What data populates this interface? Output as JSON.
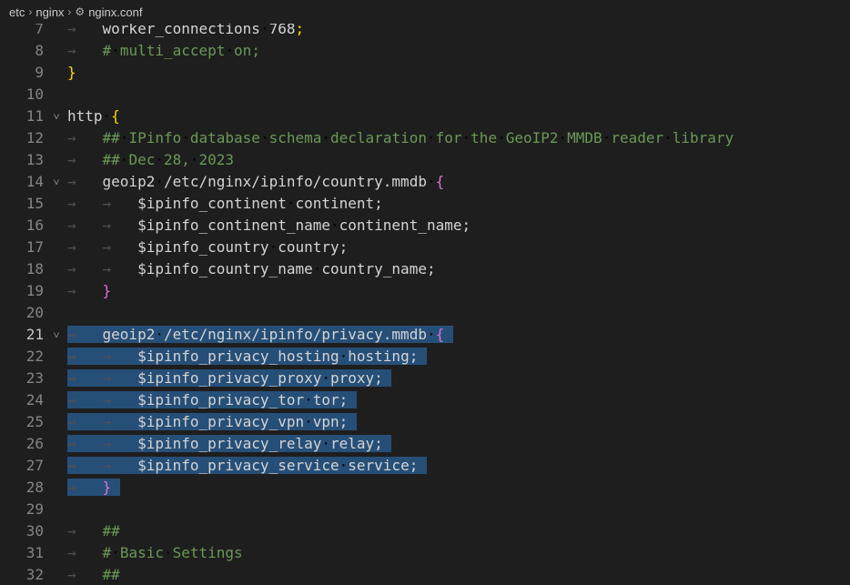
{
  "breadcrumb": {
    "items": [
      "etc",
      "nginx",
      "nginx.conf"
    ],
    "file_icon": "gear-icon"
  },
  "colors": {
    "background": "#1e1e1e",
    "selection": "#264f78",
    "comment": "#6a9955",
    "default": "#d4d4d4",
    "brace_level1": "#ffd700",
    "brace_level2": "#da70d6",
    "line_number": "#858585",
    "whitespace": "#505050"
  },
  "editor": {
    "active_line": 21,
    "lines": [
      {
        "n": "7",
        "indent": 1,
        "fold": "",
        "tokens": [
          {
            "t": "worker_connections",
            "c": "default"
          },
          {
            "t": " ",
            "c": "ws"
          },
          {
            "t": "768",
            "c": "default"
          },
          {
            "t": ";",
            "c": "brace1"
          }
        ]
      },
      {
        "n": "8",
        "indent": 1,
        "fold": "",
        "tokens": [
          {
            "t": "#",
            "c": "comment"
          },
          {
            "t": " ",
            "c": "ws"
          },
          {
            "t": "multi_accept",
            "c": "comment"
          },
          {
            "t": " ",
            "c": "ws"
          },
          {
            "t": "on;",
            "c": "comment"
          }
        ]
      },
      {
        "n": "9",
        "indent": 0,
        "fold": "",
        "tokens": [
          {
            "t": "}",
            "c": "brace1"
          }
        ]
      },
      {
        "n": "10",
        "indent": 0,
        "fold": "",
        "tokens": []
      },
      {
        "n": "11",
        "indent": 0,
        "fold": "open",
        "tokens": [
          {
            "t": "http",
            "c": "default"
          },
          {
            "t": " ",
            "c": "ws"
          },
          {
            "t": "{",
            "c": "brace1"
          }
        ]
      },
      {
        "n": "12",
        "indent": 1,
        "fold": "",
        "tokens": [
          {
            "t": "##",
            "c": "comment"
          },
          {
            "t": " ",
            "c": "ws"
          },
          {
            "t": "IPinfo",
            "c": "comment"
          },
          {
            "t": " ",
            "c": "ws"
          },
          {
            "t": "database",
            "c": "comment"
          },
          {
            "t": " ",
            "c": "ws"
          },
          {
            "t": "schema",
            "c": "comment"
          },
          {
            "t": " ",
            "c": "ws"
          },
          {
            "t": "declaration",
            "c": "comment"
          },
          {
            "t": " ",
            "c": "ws"
          },
          {
            "t": "for",
            "c": "comment"
          },
          {
            "t": " ",
            "c": "ws"
          },
          {
            "t": "the",
            "c": "comment"
          },
          {
            "t": " ",
            "c": "ws"
          },
          {
            "t": "GeoIP2",
            "c": "comment"
          },
          {
            "t": " ",
            "c": "ws"
          },
          {
            "t": "MMDB",
            "c": "comment"
          },
          {
            "t": " ",
            "c": "ws"
          },
          {
            "t": "reader",
            "c": "comment"
          },
          {
            "t": " ",
            "c": "ws"
          },
          {
            "t": "library",
            "c": "comment"
          }
        ]
      },
      {
        "n": "13",
        "indent": 1,
        "fold": "",
        "tokens": [
          {
            "t": "##",
            "c": "comment"
          },
          {
            "t": " ",
            "c": "ws"
          },
          {
            "t": "Dec",
            "c": "comment"
          },
          {
            "t": " ",
            "c": "ws"
          },
          {
            "t": "28,",
            "c": "comment"
          },
          {
            "t": " ",
            "c": "ws"
          },
          {
            "t": "2023",
            "c": "comment"
          }
        ]
      },
      {
        "n": "14",
        "indent": 1,
        "fold": "open",
        "tokens": [
          {
            "t": "geoip2",
            "c": "default"
          },
          {
            "t": " ",
            "c": "ws"
          },
          {
            "t": "/etc/nginx/ipinfo/country.mmdb",
            "c": "default"
          },
          {
            "t": " ",
            "c": "ws"
          },
          {
            "t": "{",
            "c": "brace2"
          }
        ]
      },
      {
        "n": "15",
        "indent": 2,
        "fold": "",
        "tokens": [
          {
            "t": "$ipinfo_continent",
            "c": "default"
          },
          {
            "t": " ",
            "c": "ws"
          },
          {
            "t": "continent;",
            "c": "default"
          }
        ]
      },
      {
        "n": "16",
        "indent": 2,
        "fold": "",
        "tokens": [
          {
            "t": "$ipinfo_continent_name",
            "c": "default"
          },
          {
            "t": " ",
            "c": "ws"
          },
          {
            "t": "continent_name;",
            "c": "default"
          }
        ]
      },
      {
        "n": "17",
        "indent": 2,
        "fold": "",
        "tokens": [
          {
            "t": "$ipinfo_country",
            "c": "default"
          },
          {
            "t": " ",
            "c": "ws"
          },
          {
            "t": "country;",
            "c": "default"
          }
        ]
      },
      {
        "n": "18",
        "indent": 2,
        "fold": "",
        "tokens": [
          {
            "t": "$ipinfo_country_name",
            "c": "default"
          },
          {
            "t": " ",
            "c": "ws"
          },
          {
            "t": "country_name;",
            "c": "default"
          }
        ]
      },
      {
        "n": "19",
        "indent": 1,
        "fold": "",
        "tokens": [
          {
            "t": "}",
            "c": "brace2"
          }
        ]
      },
      {
        "n": "20",
        "indent": 0,
        "fold": "",
        "tokens": []
      },
      {
        "n": "21",
        "indent": 1,
        "fold": "open",
        "sel": true,
        "tokens": [
          {
            "t": "geoip2",
            "c": "default"
          },
          {
            "t": " ",
            "c": "ws"
          },
          {
            "t": "/etc/nginx/ipinfo/privacy.mmdb",
            "c": "default"
          },
          {
            "t": " ",
            "c": "ws"
          },
          {
            "t": "{",
            "c": "brace2"
          }
        ]
      },
      {
        "n": "22",
        "indent": 2,
        "fold": "",
        "sel": true,
        "tokens": [
          {
            "t": "$ipinfo_privacy_hosting",
            "c": "default"
          },
          {
            "t": " ",
            "c": "ws"
          },
          {
            "t": "hosting;",
            "c": "default"
          }
        ]
      },
      {
        "n": "23",
        "indent": 2,
        "fold": "",
        "sel": true,
        "tokens": [
          {
            "t": "$ipinfo_privacy_proxy",
            "c": "default"
          },
          {
            "t": " ",
            "c": "ws"
          },
          {
            "t": "proxy;",
            "c": "default"
          }
        ]
      },
      {
        "n": "24",
        "indent": 2,
        "fold": "",
        "sel": true,
        "tokens": [
          {
            "t": "$ipinfo_privacy_tor",
            "c": "default"
          },
          {
            "t": " ",
            "c": "ws"
          },
          {
            "t": "tor;",
            "c": "default"
          }
        ]
      },
      {
        "n": "25",
        "indent": 2,
        "fold": "",
        "sel": true,
        "tokens": [
          {
            "t": "$ipinfo_privacy_vpn",
            "c": "default"
          },
          {
            "t": " ",
            "c": "ws"
          },
          {
            "t": "vpn;",
            "c": "default"
          }
        ]
      },
      {
        "n": "26",
        "indent": 2,
        "fold": "",
        "sel": true,
        "tokens": [
          {
            "t": "$ipinfo_privacy_relay",
            "c": "default"
          },
          {
            "t": " ",
            "c": "ws"
          },
          {
            "t": "relay;",
            "c": "default"
          }
        ]
      },
      {
        "n": "27",
        "indent": 2,
        "fold": "",
        "sel": true,
        "tokens": [
          {
            "t": "$ipinfo_privacy_service",
            "c": "default"
          },
          {
            "t": " ",
            "c": "ws"
          },
          {
            "t": "service;",
            "c": "default"
          }
        ]
      },
      {
        "n": "28",
        "indent": 1,
        "fold": "",
        "sel": true,
        "tokens": [
          {
            "t": "}",
            "c": "brace2"
          }
        ]
      },
      {
        "n": "29",
        "indent": 0,
        "fold": "",
        "tokens": []
      },
      {
        "n": "30",
        "indent": 1,
        "fold": "",
        "tokens": [
          {
            "t": "##",
            "c": "comment"
          }
        ]
      },
      {
        "n": "31",
        "indent": 1,
        "fold": "",
        "tokens": [
          {
            "t": "#",
            "c": "comment"
          },
          {
            "t": " ",
            "c": "ws"
          },
          {
            "t": "Basic",
            "c": "comment"
          },
          {
            "t": " ",
            "c": "ws"
          },
          {
            "t": "Settings",
            "c": "comment"
          }
        ]
      },
      {
        "n": "32",
        "indent": 1,
        "fold": "",
        "tokens": [
          {
            "t": "##",
            "c": "comment"
          }
        ]
      }
    ]
  }
}
